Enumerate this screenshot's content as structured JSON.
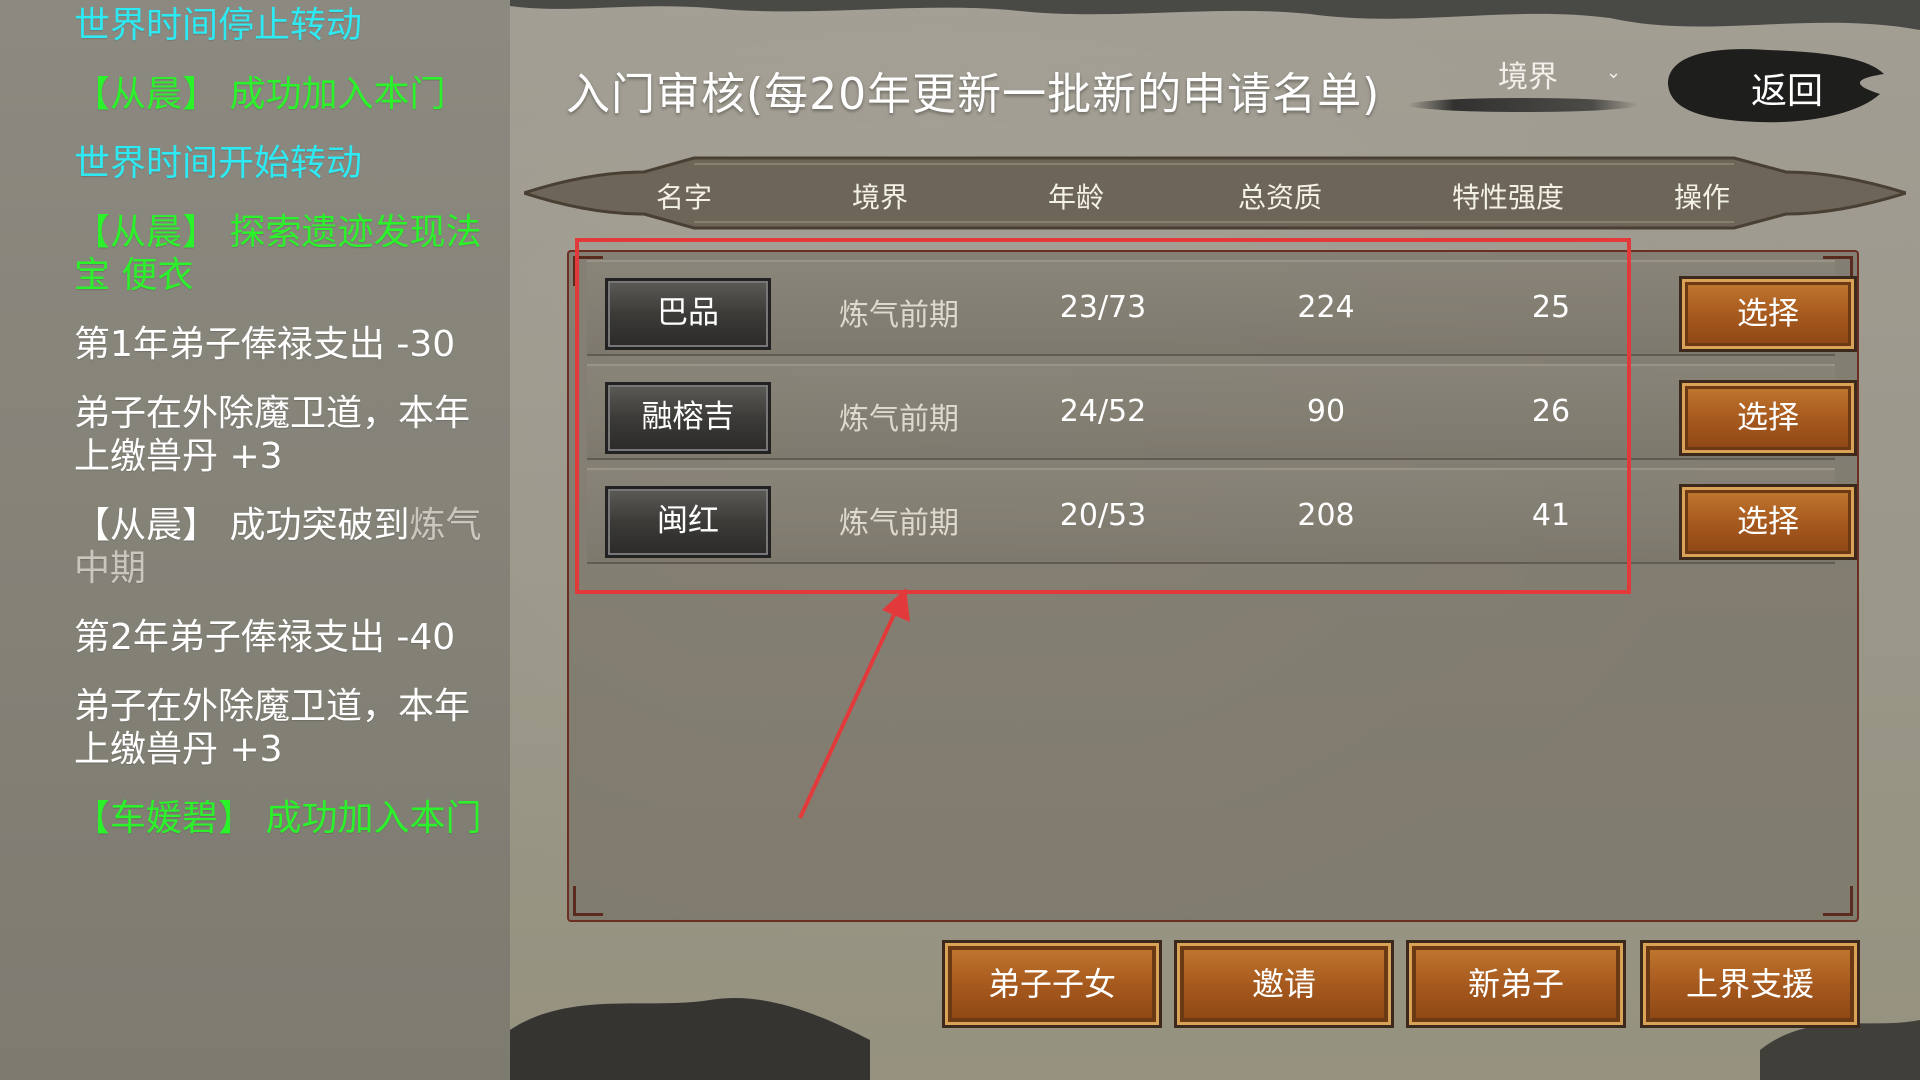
{
  "log": {
    "entries": [
      {
        "text": "世界时间停止转动",
        "color": "cyan"
      },
      {
        "text": "【从晨】 成功加入本门",
        "color": "green"
      },
      {
        "text": "世界时间开始转动",
        "color": "cyan"
      },
      {
        "text": "【从晨】 探索遗迹发现法宝 便衣",
        "color": "green"
      },
      {
        "text": "第1年弟子俸禄支出 -30",
        "color": "white"
      },
      {
        "text": "弟子在外除魔卫道，本年上缴兽丹 +3",
        "color": "white"
      },
      {
        "text": "【从晨】 成功突破到",
        "muted": "炼气中期",
        "color": "white"
      },
      {
        "text": "第2年弟子俸禄支出 -40",
        "color": "white"
      },
      {
        "text": "弟子在外除魔卫道，本年上缴兽丹 +3",
        "color": "white"
      },
      {
        "text": "【车媛碧】 成功加入本门",
        "color": "green"
      }
    ]
  },
  "header": {
    "title": "入门审核(每20年更新一批新的申请名单)",
    "realm_filter": "境界",
    "back_label": "返回"
  },
  "table": {
    "columns": [
      "名字",
      "境界",
      "年龄",
      "总资质",
      "特性强度",
      "操作"
    ],
    "rows": [
      {
        "name": "巴品",
        "realm": "炼气前期",
        "age": "23/73",
        "aptitude": "224",
        "trait": "25",
        "action": "选择"
      },
      {
        "name": "融榕吉",
        "realm": "炼气前期",
        "age": "24/52",
        "aptitude": "90",
        "trait": "26",
        "action": "选择"
      },
      {
        "name": "闽红",
        "realm": "炼气前期",
        "age": "20/53",
        "aptitude": "208",
        "trait": "41",
        "action": "选择"
      }
    ]
  },
  "bottom_buttons": [
    "弟子子女",
    "邀请",
    "新弟子",
    "上界支援"
  ],
  "colors": {
    "cyan_log": "#2ee8f2",
    "green_log": "#2bf22b",
    "button_orange": "#a75a1e",
    "annotation_red": "#e23a3a"
  }
}
